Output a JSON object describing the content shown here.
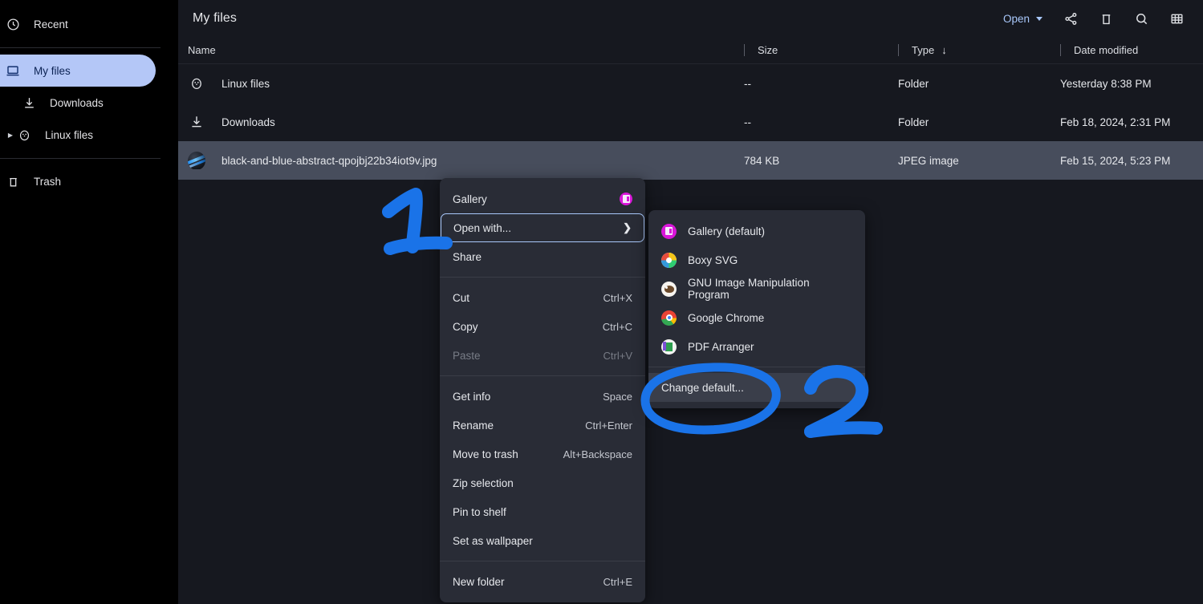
{
  "accent_colors": {
    "sidebar_selected_bg": "#b4c7f7",
    "sidebar_selected_fg": "#0b2253",
    "open_link": "#a8c7fa",
    "row_selected_bg": "#474d5c",
    "menu_bg": "#292c36",
    "page_bg": "#16181f",
    "sidebar_bg": "#000000",
    "annotation_blue": "#1a73e8",
    "focus_ring": "#a8c7fa"
  },
  "sidebar": {
    "items": [
      {
        "label": "Recent",
        "icon": "clock-icon",
        "selected": false,
        "indent": 0,
        "expandable": false
      },
      {
        "label": "My files",
        "icon": "laptop-icon",
        "selected": true,
        "indent": 0,
        "expandable": false
      },
      {
        "label": "Downloads",
        "icon": "download-icon",
        "selected": false,
        "indent": 1,
        "expandable": false
      },
      {
        "label": "Linux files",
        "icon": "penguin-icon",
        "selected": false,
        "indent": 0,
        "expandable": true
      },
      {
        "label": "Trash",
        "icon": "trash-icon",
        "selected": false,
        "indent": 0,
        "expandable": false
      }
    ]
  },
  "header": {
    "title": "My files",
    "open_label": "Open",
    "icons": [
      {
        "name": "share-icon",
        "glyph": "share"
      },
      {
        "name": "delete-icon",
        "glyph": "trash"
      },
      {
        "name": "search-icon",
        "glyph": "search"
      },
      {
        "name": "view-grid-icon",
        "glyph": "grid"
      }
    ]
  },
  "columns": {
    "name": "Name",
    "size": "Size",
    "type": "Type",
    "date": "Date modified",
    "sorted_by": "Type",
    "sort_arrow": "↓"
  },
  "files": [
    {
      "name": "Linux files",
      "icon": "penguin-icon",
      "size": "--",
      "type": "Folder",
      "date": "Yesterday 8:38 PM",
      "selected": false
    },
    {
      "name": "Downloads",
      "icon": "download-icon",
      "size": "--",
      "type": "Folder",
      "date": "Feb 18, 2024, 2:31 PM",
      "selected": false
    },
    {
      "name": "black-and-blue-abstract-qpojbj22b34iot9v.jpg",
      "icon": "image-thumbnail",
      "size": "784 KB",
      "type": "JPEG image",
      "date": "Feb 15, 2024, 5:23 PM",
      "selected": true
    }
  ],
  "context_menu": {
    "groups": [
      {
        "items": [
          {
            "label": "Gallery",
            "accel": "",
            "trailing": "app-icon-gallery",
            "state": "normal"
          },
          {
            "label": "Open with...",
            "accel": "",
            "trailing": "chevron-right-icon",
            "state": "focused"
          },
          {
            "label": "Share",
            "accel": "",
            "trailing": "",
            "state": "normal"
          }
        ]
      },
      {
        "items": [
          {
            "label": "Cut",
            "accel": "Ctrl+X",
            "trailing": "",
            "state": "normal"
          },
          {
            "label": "Copy",
            "accel": "Ctrl+C",
            "trailing": "",
            "state": "normal"
          },
          {
            "label": "Paste",
            "accel": "Ctrl+V",
            "trailing": "",
            "state": "disabled"
          }
        ]
      },
      {
        "items": [
          {
            "label": "Get info",
            "accel": "Space",
            "trailing": "",
            "state": "normal"
          },
          {
            "label": "Rename",
            "accel": "Ctrl+Enter",
            "trailing": "",
            "state": "normal"
          },
          {
            "label": "Move to trash",
            "accel": "Alt+Backspace",
            "trailing": "",
            "state": "normal"
          },
          {
            "label": "Zip selection",
            "accel": "",
            "trailing": "",
            "state": "normal"
          },
          {
            "label": "Pin to shelf",
            "accel": "",
            "trailing": "",
            "state": "normal"
          },
          {
            "label": "Set as wallpaper",
            "accel": "",
            "trailing": "",
            "state": "normal"
          }
        ]
      },
      {
        "items": [
          {
            "label": "New folder",
            "accel": "Ctrl+E",
            "trailing": "",
            "state": "normal"
          }
        ]
      }
    ]
  },
  "open_with_submenu": {
    "apps": [
      {
        "label": "Gallery (default)",
        "icon": "gallery-app-icon",
        "hover": false
      },
      {
        "label": "Boxy SVG",
        "icon": "boxy-svg-app-icon",
        "hover": false
      },
      {
        "label": "GNU Image Manipulation Program",
        "icon": "gimp-app-icon",
        "hover": false
      },
      {
        "label": "Google Chrome",
        "icon": "chrome-app-icon",
        "hover": false
      },
      {
        "label": "PDF Arranger",
        "icon": "pdf-arranger-app-icon",
        "hover": false
      }
    ],
    "footer": {
      "label": "Change default...",
      "hover": true
    }
  },
  "annotations": [
    {
      "text": "1",
      "kind": "handwritten-number"
    },
    {
      "text": "2",
      "kind": "handwritten-number"
    },
    {
      "text": "",
      "kind": "handwritten-circle"
    }
  ]
}
